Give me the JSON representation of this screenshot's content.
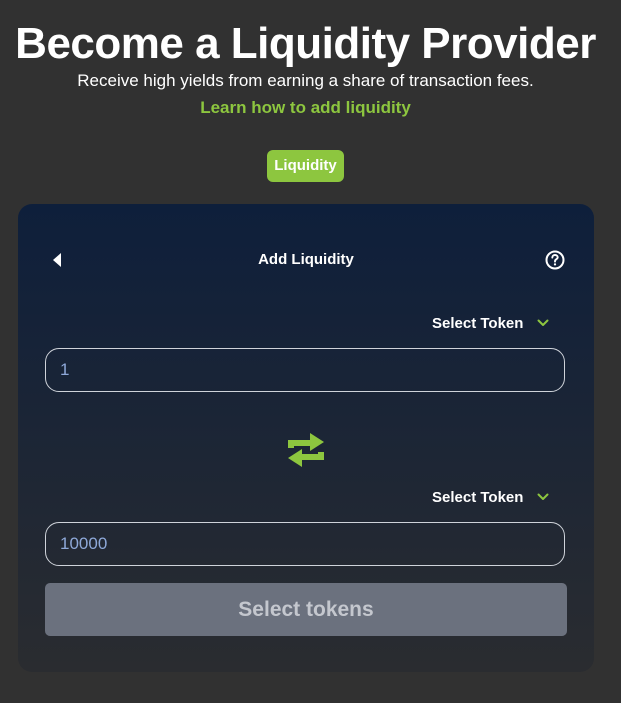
{
  "hero": {
    "title": "Become a Liquidity Provider",
    "subtitle": "Receive high yields from earning a share of transaction fees.",
    "learn_link": "Learn how to add liquidity"
  },
  "tab": {
    "label": "Liquidity"
  },
  "card": {
    "title": "Add Liquidity",
    "back_icon": "back-triangle-icon",
    "help_icon": "question-circle-icon",
    "first": {
      "select_label": "Select Token",
      "amount": "1"
    },
    "swap_icon": "swap-arrows-icon",
    "second": {
      "select_label": "Select Token",
      "amount": "10000"
    },
    "submit_label": "Select tokens"
  },
  "colors": {
    "accent": "#8dc63f",
    "background": "#313131",
    "card_top": "#0e1f3b",
    "card_bottom": "#2a2c30",
    "disabled_button": "#6b717e",
    "input_text": "#8ea8d8"
  }
}
